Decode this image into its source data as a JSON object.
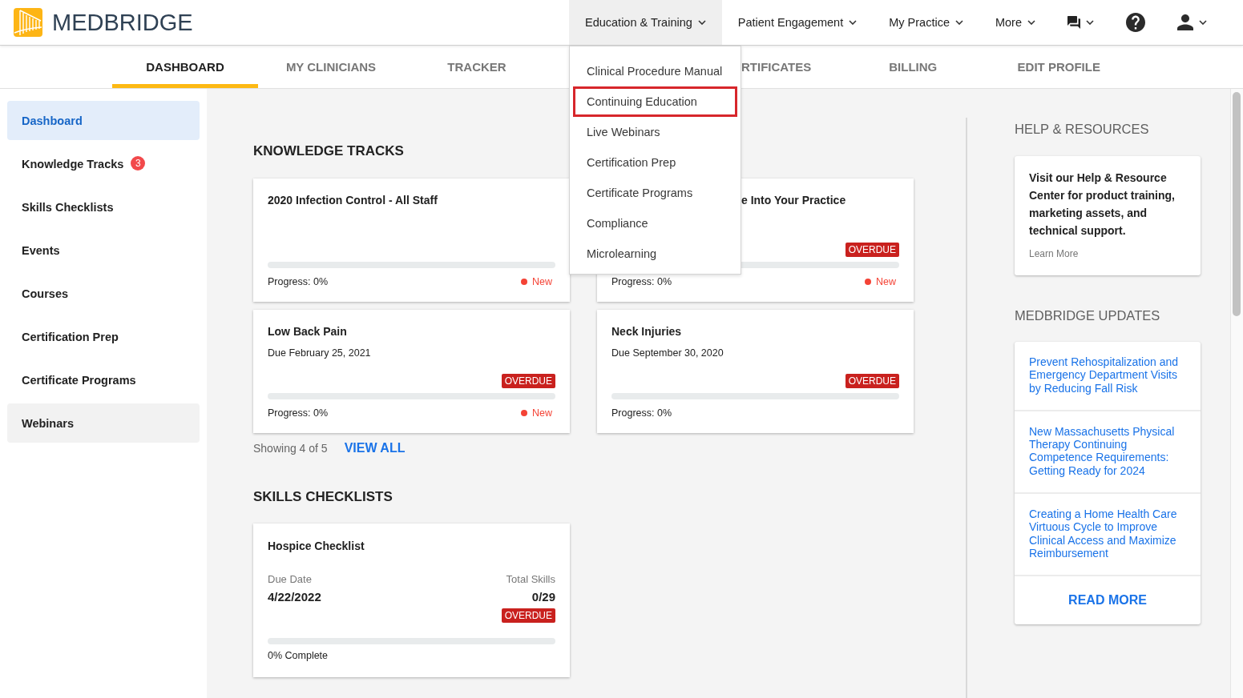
{
  "header": {
    "logo": {
      "text": "MEDBRIDGE"
    },
    "nav": [
      {
        "kind": "menu",
        "label": "Education & Training",
        "expanded": true,
        "items": [
          {
            "label": "Clinical Procedure Manual",
            "highlighted": false
          },
          {
            "label": "Continuing Education",
            "highlighted": true
          },
          {
            "label": "Live Webinars",
            "highlighted": false
          },
          {
            "label": "Certification Prep",
            "highlighted": false
          },
          {
            "label": "Certificate Programs",
            "highlighted": false
          },
          {
            "label": "Compliance",
            "highlighted": false
          },
          {
            "label": "Microlearning",
            "highlighted": false
          }
        ]
      },
      {
        "kind": "menu",
        "label": "Patient Engagement",
        "expanded": false
      },
      {
        "kind": "menu",
        "label": "My Practice",
        "expanded": false
      },
      {
        "kind": "menu",
        "label": "More",
        "expanded": false
      },
      {
        "kind": "messages",
        "expanded": false
      },
      {
        "kind": "help"
      },
      {
        "kind": "account",
        "expanded": false
      }
    ]
  },
  "tabs": [
    {
      "label": "DASHBOARD",
      "selected": true,
      "clipped": false
    },
    {
      "label": "MY CLINICIANS",
      "selected": false,
      "clipped": false
    },
    {
      "label": "TRACKER",
      "selected": false,
      "clipped": false
    },
    {
      "label": "RTIFICATES",
      "selected": false,
      "clipped": true
    },
    {
      "label": "BILLING",
      "selected": false,
      "clipped": false
    },
    {
      "label": "EDIT PROFILE",
      "selected": false,
      "clipped": false
    }
  ],
  "sidebar": {
    "items": [
      {
        "label": "Dashboard",
        "selected": true,
        "hovered": false
      },
      {
        "label": "Knowledge Tracks",
        "selected": false,
        "hovered": false,
        "badge": "3"
      },
      {
        "label": "Skills Checklists",
        "selected": false,
        "hovered": false
      },
      {
        "label": "Events",
        "selected": false,
        "hovered": false
      },
      {
        "label": "Courses",
        "selected": false,
        "hovered": false
      },
      {
        "label": "Certification Prep",
        "selected": false,
        "hovered": false
      },
      {
        "label": "Certificate Programs",
        "selected": false,
        "hovered": false
      },
      {
        "label": "Webinars",
        "selected": false,
        "hovered": true
      }
    ]
  },
  "knowledge_tracks": {
    "title": "KNOWLEDGE TRACKS",
    "cards": [
      {
        "title": "2020 Infection Control - All Staff",
        "title_clipped": false,
        "level": 0,
        "progress_label": "Progress: 0%",
        "status": "New"
      },
      {
        "title": "e Into Your Practice",
        "title_clipped": true,
        "badge": "OVERDUE",
        "level": 0,
        "progress_label": "Progress: 0%",
        "status": "New"
      },
      {
        "title": "Low Back Pain",
        "title_clipped": false,
        "due": "Due February 25, 2021",
        "badge": "OVERDUE",
        "level": 0,
        "progress_label": "Progress: 0%",
        "status": "New"
      },
      {
        "title": "Neck Injuries",
        "title_clipped": false,
        "due": "Due September 30, 2020",
        "badge": "OVERDUE",
        "level": 0,
        "progress_label": "Progress: 0%"
      }
    ],
    "summary": "Showing 4 of 5",
    "view_all": "VIEW ALL"
  },
  "skills_checklists": {
    "title": "SKILLS CHECKLISTS",
    "cards": [
      {
        "title": "Hospice Checklist",
        "due_label": "Due Date",
        "due_value": "4/22/2022",
        "total_label": "Total Skills",
        "total_value": "0/29",
        "badge": "OVERDUE",
        "level": 0,
        "progress_label": "0% Complete"
      }
    ]
  },
  "help_resources": {
    "title": "HELP & RESOURCES",
    "text": "Visit our Help & Resource Center for product training, marketing assets, and technical support.",
    "link": "Learn More"
  },
  "updates": {
    "title": "MEDBRIDGE UPDATES",
    "items": [
      "Prevent Rehospitalization and Emergency Department Visits by Reducing Fall Risk",
      "New Massachusetts Physical Therapy Continuing Competence Requirements: Getting Ready for 2024",
      "Creating a Home Health Care Virtuous Cycle to Improve Clinical Access and Maximize Reimbursement"
    ],
    "read_more": "READ MORE"
  }
}
